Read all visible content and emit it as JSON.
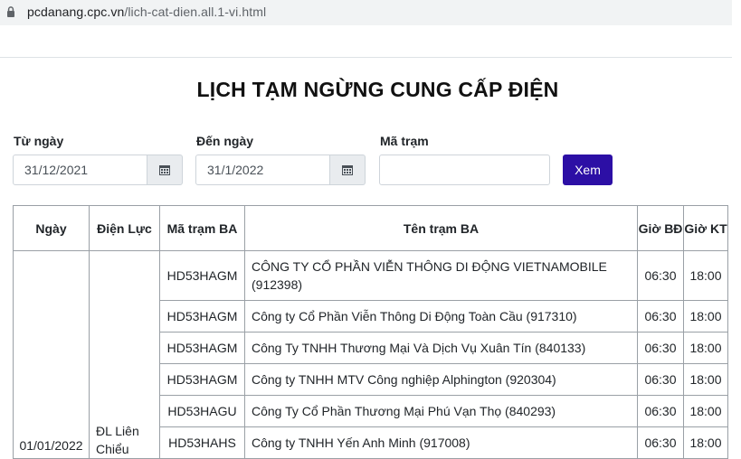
{
  "browser": {
    "url_host": "pcdanang.cpc.vn",
    "url_path": "/lich-cat-dien.all.1-vi.html"
  },
  "page": {
    "title": "LỊCH TẠM NGỪNG CUNG CẤP ĐIỆN"
  },
  "filters": {
    "from_label": "Từ ngày",
    "from_value": "31/12/2021",
    "to_label": "Đến ngày",
    "to_value": "31/1/2022",
    "station_label": "Mã trạm",
    "station_value": "",
    "submit_label": "Xem"
  },
  "table": {
    "headers": [
      "Ngày",
      "Điện Lực",
      "Mã trạm BA",
      "Tên trạm BA",
      "Giờ BĐ",
      "Giờ KT"
    ],
    "group": {
      "date": "01/01/2022",
      "district": "ĐL Liên Chiểu"
    },
    "rows": [
      {
        "code": "HD53HAGM",
        "name": "CÔNG TY CỔ PHẦN VIỄN THÔNG DI ĐỘNG VIETNAMOBILE (912398)",
        "start": "06:30",
        "end": "18:00"
      },
      {
        "code": "HD53HAGM",
        "name": "Công ty Cổ Phần Viễn Thông Di Động Toàn Cầu (917310)",
        "start": "06:30",
        "end": "18:00"
      },
      {
        "code": "HD53HAGM",
        "name": "Công Ty TNHH Thương Mại Và Dịch Vụ Xuân Tín (840133)",
        "start": "06:30",
        "end": "18:00"
      },
      {
        "code": "HD53HAGM",
        "name": "Công ty TNHH MTV Công nghiệp Alphington (920304)",
        "start": "06:30",
        "end": "18:00"
      },
      {
        "code": "HD53HAGU",
        "name": "Công Ty Cổ Phần Thương Mại Phú Vạn Thọ (840293)",
        "start": "06:30",
        "end": "18:00"
      },
      {
        "code": "HD53HAHS",
        "name": "Công ty TNHH Yến Anh Minh (917008)",
        "start": "06:30",
        "end": "18:00"
      }
    ]
  },
  "colors": {
    "accent": "#2c0fa5",
    "border": "#9aa0a6"
  }
}
